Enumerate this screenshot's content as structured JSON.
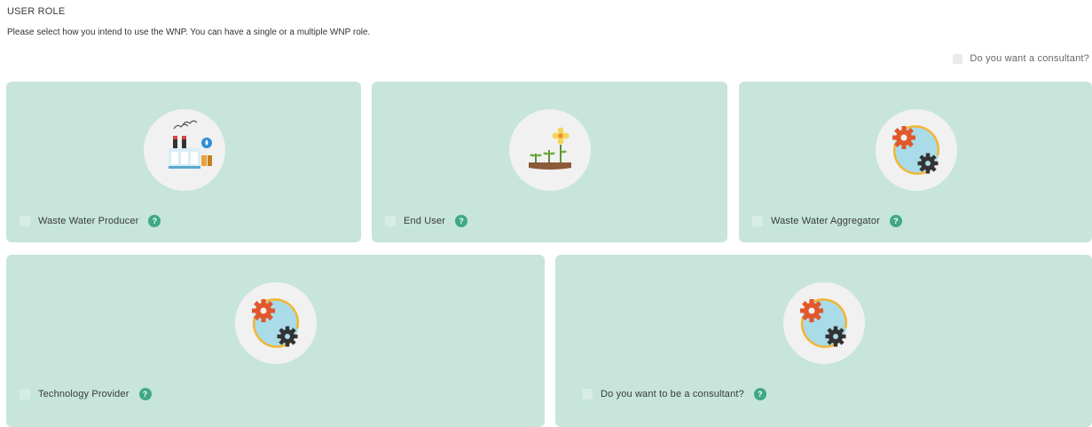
{
  "header": {
    "title": "USER ROLE",
    "description": "Please select how you intend to use the WNP. You can have a single or a multiple WNP role."
  },
  "consultant_option": {
    "label": "Do you want a consultant?"
  },
  "roles": [
    {
      "label": "Waste Water Producer",
      "icon": "factory-icon"
    },
    {
      "label": "End User",
      "icon": "plant-sprout-icon"
    },
    {
      "label": "Waste Water Aggregator",
      "icon": "gears-icon"
    },
    {
      "label": "Technology Provider",
      "icon": "gears-icon"
    },
    {
      "label": "Do you want to be a consultant?",
      "icon": "gears-icon"
    }
  ],
  "help_glyph": "?",
  "colors": {
    "card_bg": "#c7e5db",
    "help_badge": "#3fa886",
    "icon_circle": "#f1f1f1"
  }
}
